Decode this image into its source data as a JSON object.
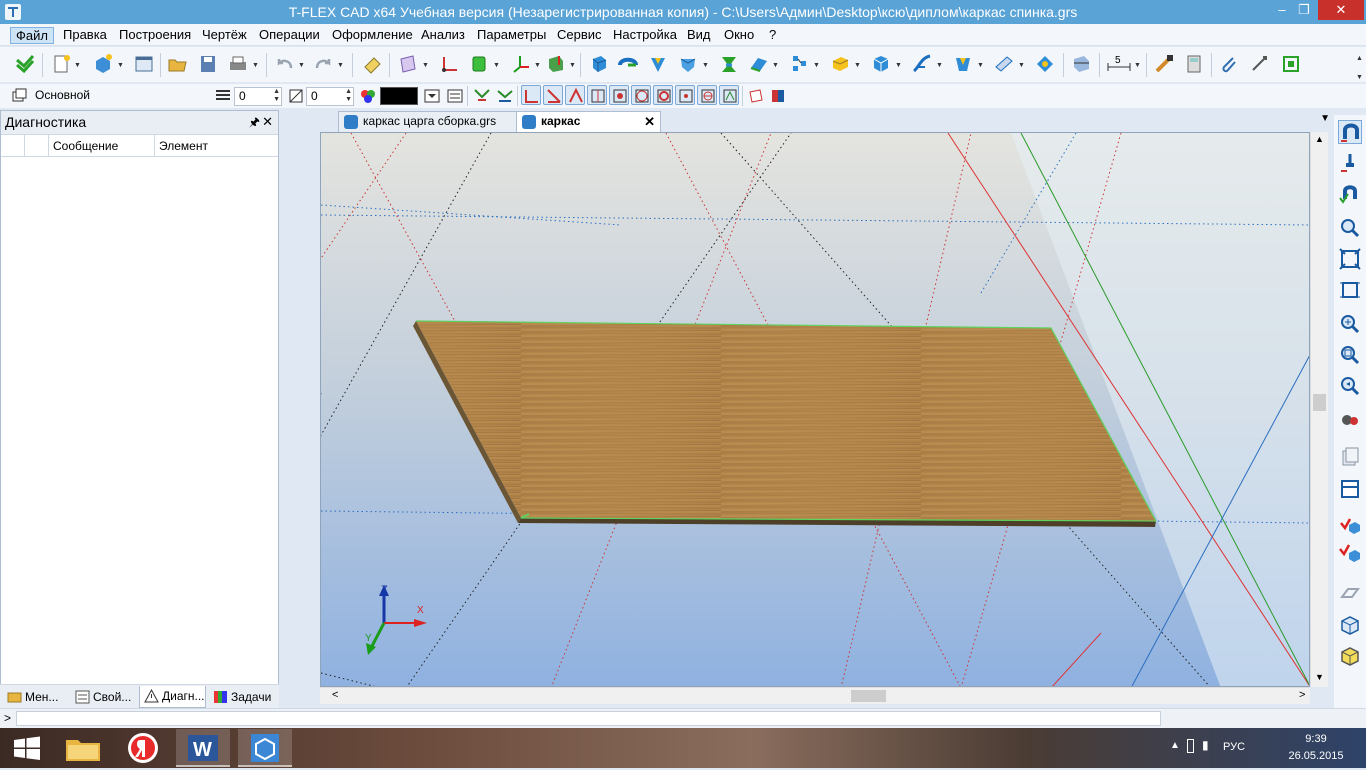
{
  "window": {
    "title": "T-FLEX CAD x64 Учебная версия (Незарегистрированная копия) - C:\\Users\\Админ\\Desktop\\ксю\\диплом\\каркас спинка.grs",
    "minimize": "–",
    "restore": "❐",
    "close": "✕"
  },
  "menu": [
    "Файл",
    "Правка",
    "Построения",
    "Чертёж",
    "Операции",
    "Оформление",
    "Анализ",
    "Параметры",
    "Сервис",
    "Настройка",
    "Вид",
    "Окно",
    "?"
  ],
  "toolbar2": {
    "layer_name": "Основной",
    "level_value": "0",
    "priority_value": "0",
    "color_value": "#000000"
  },
  "toolbar1": {
    "dim_label": "5"
  },
  "left_panel": {
    "title": "Диагностика",
    "pin": "▫",
    "close": "✕",
    "columns": [
      "",
      "Сообщение",
      "Элемент"
    ],
    "bottom_tabs": [
      "Мен...",
      "Свой...",
      "Диагн...",
      "Задачи"
    ]
  },
  "doc_tabs": [
    {
      "label": "каркас царга сборка.grs",
      "active": false
    },
    {
      "label": "каркас спинка.grs",
      "active": true
    }
  ],
  "viewport": {
    "axis_labels": {
      "z": "Z",
      "x": "X",
      "y": "Y"
    }
  },
  "status": {
    "prompt": ">"
  },
  "taskbar": {
    "lang": "РУС",
    "time": "9:39",
    "date": "26.05.2015"
  },
  "icons": {
    "app": "tflex-icon",
    "start": "windows-logo-icon",
    "explorer": "folder-icon",
    "yandex": "yandex-browser-icon",
    "word": "word-icon",
    "tflex_task": "tflex-task-icon"
  },
  "colors": {
    "titlebar": "#5aa3d6",
    "plate_wood": "#b98b4e",
    "plate_edge": "#5a4a32",
    "highlight_edge": "#5fd25f",
    "axis_x": "#d22",
    "axis_y": "#1a9d1a",
    "axis_z": "#1737a8"
  }
}
